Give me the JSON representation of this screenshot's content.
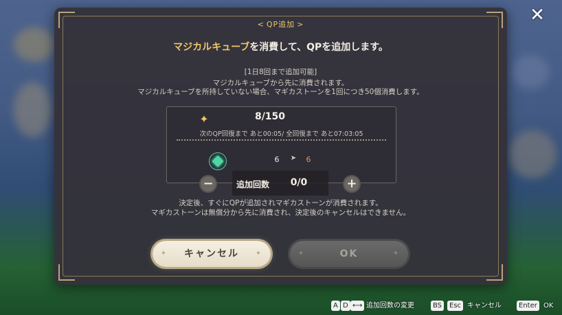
{
  "dialog": {
    "title": "QP追加",
    "headline_highlight": "マジカルキューブ",
    "headline_rest": "を消費して、QPを追加します。",
    "limit_note": "[1日8回まで追加可能]",
    "desc_line1": "マジカルキューブから先に消費されます。",
    "desc_line2": "マジカルキューブを所持していない場合、マギカストーンを1回につき50個消費します。",
    "qp_value": "8/150",
    "recover_text": "次のQP回復まで あと00:05/ 全回復まで あと07:03:05",
    "cube_before": "6",
    "cube_after": "6",
    "stepper_label": "追加回数",
    "stepper_value": "0/0",
    "note_line1": "決定後、すぐにQPが追加されマギカストーンが消費されます。",
    "note_line2": "マギカストーンは無償分から先に消費され、決定後のキャンセルはできません。",
    "cancel_label": "キャンセル",
    "ok_label": "OK"
  },
  "hints": {
    "key_ad": "A",
    "key_d": "D",
    "ad_text": "追加回数の変更",
    "key_bs": "BS",
    "key_esc": "Esc",
    "cancel_text": "キャンセル",
    "key_enter": "Enter",
    "ok_text": "OK"
  },
  "icons": {
    "qp": "sparkle-icon",
    "cube": "magical-cube-icon",
    "close": "close-icon",
    "minus": "minus-icon",
    "plus": "plus-icon",
    "arrow": "arrow-right-icon"
  },
  "colors": {
    "accent_gold": "#f0c766",
    "after_value": "#f08e73",
    "panel_bg": "#34323a"
  }
}
